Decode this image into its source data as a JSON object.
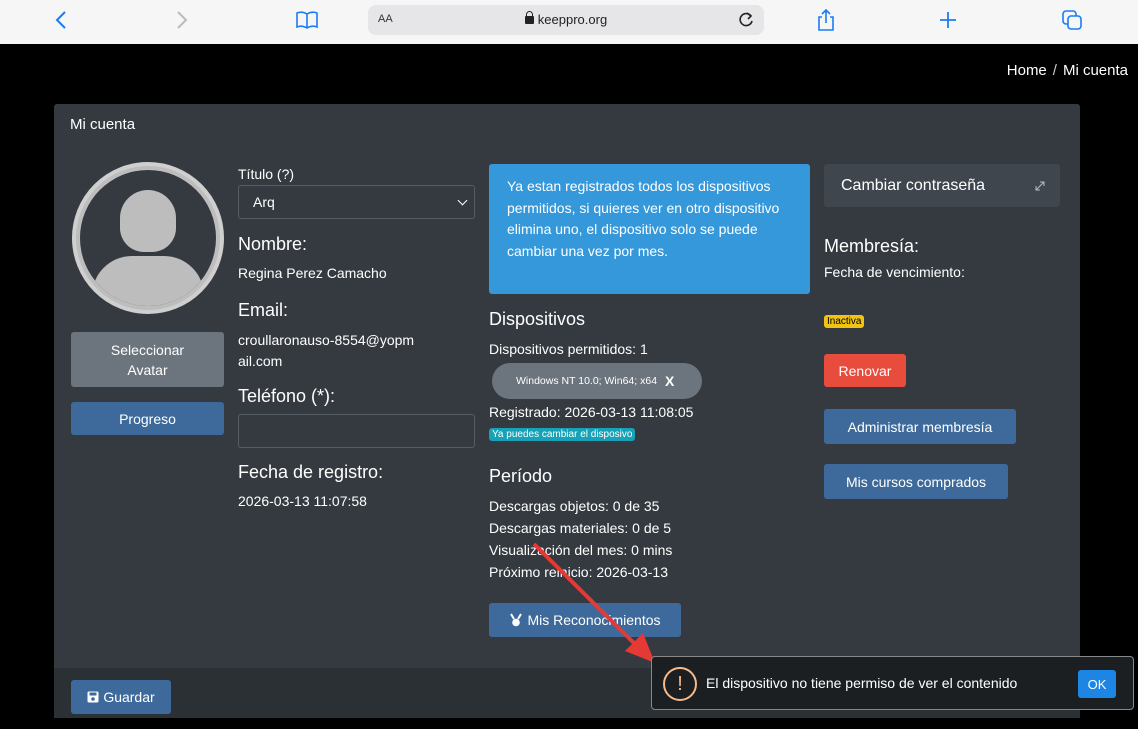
{
  "browser": {
    "text_size_label": "AA",
    "url": "keeppro.org"
  },
  "breadcrumb": {
    "home": "Home",
    "separator": "/",
    "current": "Mi cuenta"
  },
  "card": {
    "title": "Mi cuenta"
  },
  "profile": {
    "select_avatar_label": "Seleccionar Avatar",
    "progress_label": "Progreso",
    "title_label": "Título (?)",
    "title_value": "Arq",
    "name_label": "Nombre:",
    "name_value": "Regina Perez Camacho",
    "email_label": "Email:",
    "email_value": "croullaronauso-8554@yopmail.com",
    "phone_label": "Teléfono (*):",
    "phone_value": "",
    "registration_label": "Fecha de registro:",
    "registration_value": "2026-03-13 11:07:58"
  },
  "devices": {
    "alert": "Ya estan registrados todos los dispositivos permitidos, si quieres ver en otro dispositivo elimina uno, el dispositivo solo se puede cambiar una vez por mes.",
    "heading": "Dispositivos",
    "allowed": "Dispositivos permitidos: 1",
    "device_name": "Windows NT 10.0; Win64; x64",
    "device_remove": "X",
    "registered": "Registrado: 2026-03-13 11:08:05",
    "change_badge": "Ya puedes cambiar el disposivo"
  },
  "period": {
    "heading": "Período",
    "objects": "Descargas objetos: 0 de 35",
    "materials": "Descargas materiales: 0 de 5",
    "views": "Visualización del mes: 0 mins",
    "next": "Próximo reinicio: 2026-03-13",
    "achievements_label": "Mis Reconocimientos"
  },
  "membership": {
    "change_password_label": "Cambiar contraseña",
    "heading": "Membresía:",
    "expiry_label": "Fecha de vencimiento:",
    "status_badge": "Inactiva",
    "renew_label": "Renovar",
    "manage_label": "Administrar membresía",
    "courses_label": "Mis cursos comprados"
  },
  "footer": {
    "save_label": "Guardar"
  },
  "toast": {
    "message": "El dispositivo no tiene permiso de ver el contenido",
    "ok_label": "OK",
    "icon": "!"
  },
  "colors": {
    "alert_info": "#3498db",
    "renew": "#e74c3c",
    "primary": "#3e6a9b",
    "toast_ok": "#1d85e4",
    "annotation_arrow": "#e53935"
  }
}
